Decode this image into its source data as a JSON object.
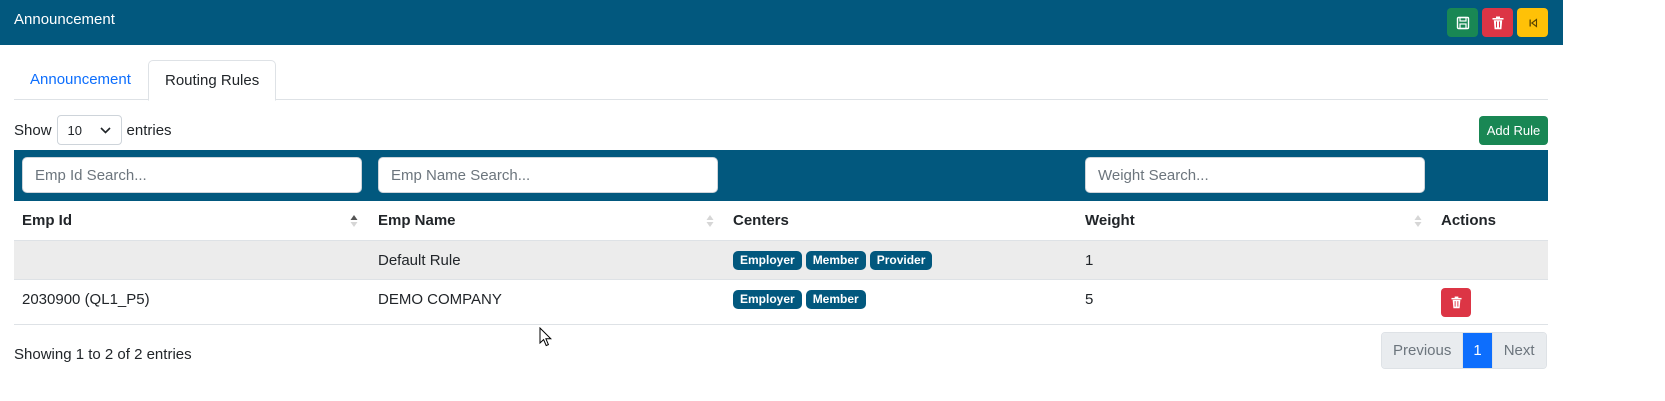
{
  "header": {
    "title": "Announcement"
  },
  "top_actions": {
    "save": "save-icon",
    "delete": "trash-icon",
    "back": "back-icon"
  },
  "tabs": [
    {
      "label": "Announcement",
      "active": false
    },
    {
      "label": "Routing Rules",
      "active": true
    }
  ],
  "length_menu": {
    "prefix": "Show",
    "value": "10",
    "suffix": "entries"
  },
  "add_rule_label": "Add Rule",
  "search": {
    "emp_id_placeholder": "Emp Id Search...",
    "emp_name_placeholder": "Emp Name Search...",
    "weight_placeholder": "Weight Search..."
  },
  "columns": [
    "Emp Id",
    "Emp Name",
    "Centers",
    "Weight",
    "Actions"
  ],
  "rows": [
    {
      "emp_id": "",
      "emp_name": "Default Rule",
      "centers": [
        "Employer",
        "Member",
        "Provider"
      ],
      "weight": "1",
      "has_delete": false
    },
    {
      "emp_id": "2030900 (QL1_P5)",
      "emp_name": "DEMO COMPANY",
      "centers": [
        "Employer",
        "Member"
      ],
      "weight": "5",
      "has_delete": true
    }
  ],
  "footer": {
    "info": "Showing 1 to 2 of 2 entries",
    "pagination": {
      "previous": "Previous",
      "current": "1",
      "next": "Next"
    }
  },
  "colors": {
    "brand": "#02587e",
    "success": "#198754",
    "danger": "#dc3545",
    "warning": "#ffc107",
    "primary": "#0d6efd"
  }
}
